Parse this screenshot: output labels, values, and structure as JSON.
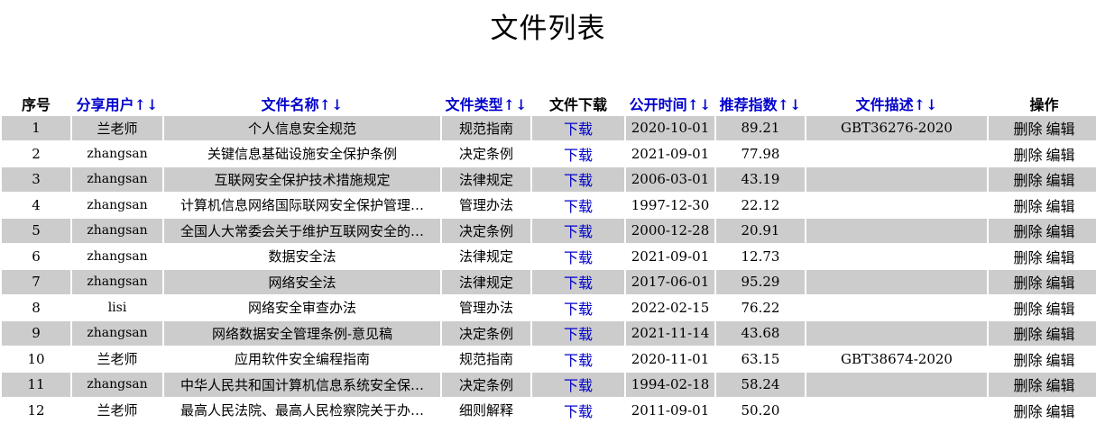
{
  "title": "文件列表",
  "columns": [
    {
      "label": "序号",
      "sortable": false
    },
    {
      "label": "分享用户↑↓",
      "sortable": true
    },
    {
      "label": "文件名称↑↓",
      "sortable": true
    },
    {
      "label": "文件类型↑↓",
      "sortable": true
    },
    {
      "label": "文件下载",
      "sortable": false
    },
    {
      "label": "公开时间↑↓",
      "sortable": true
    },
    {
      "label": "推荐指数↑↓",
      "sortable": true
    },
    {
      "label": "文件描述↑↓",
      "sortable": true
    },
    {
      "label": "操作",
      "sortable": false
    }
  ],
  "download_label": "下载",
  "delete_label": "删除",
  "edit_label": "编辑",
  "rows": [
    {
      "no": "1",
      "user": "兰老师",
      "name": "个人信息安全规范",
      "type": "规范指南",
      "date": "2020-10-01",
      "score": "89.21",
      "desc": "GBT36276-2020"
    },
    {
      "no": "2",
      "user": "zhangsan",
      "name": "关键信息基础设施安全保护条例",
      "type": "决定条例",
      "date": "2021-09-01",
      "score": "77.98",
      "desc": ""
    },
    {
      "no": "3",
      "user": "zhangsan",
      "name": "互联网安全保护技术措施规定",
      "type": "法律规定",
      "date": "2006-03-01",
      "score": "43.19",
      "desc": ""
    },
    {
      "no": "4",
      "user": "zhangsan",
      "name": "计算机信息网络国际联网安全保护管理…",
      "type": "管理办法",
      "date": "1997-12-30",
      "score": "22.12",
      "desc": ""
    },
    {
      "no": "5",
      "user": "zhangsan",
      "name": "全国人大常委会关于维护互联网安全的…",
      "type": "决定条例",
      "date": "2000-12-28",
      "score": "20.91",
      "desc": ""
    },
    {
      "no": "6",
      "user": "zhangsan",
      "name": "数据安全法",
      "type": "法律规定",
      "date": "2021-09-01",
      "score": "12.73",
      "desc": ""
    },
    {
      "no": "7",
      "user": "zhangsan",
      "name": "网络安全法",
      "type": "法律规定",
      "date": "2017-06-01",
      "score": "95.29",
      "desc": ""
    },
    {
      "no": "8",
      "user": "lisi",
      "name": "网络安全审查办法",
      "type": "管理办法",
      "date": "2022-02-15",
      "score": "76.22",
      "desc": ""
    },
    {
      "no": "9",
      "user": "zhangsan",
      "name": "网络数据安全管理条例-意见稿",
      "type": "决定条例",
      "date": "2021-11-14",
      "score": "43.68",
      "desc": ""
    },
    {
      "no": "10",
      "user": "兰老师",
      "name": "应用软件安全编程指南",
      "type": "规范指南",
      "date": "2020-11-01",
      "score": "63.15",
      "desc": "GBT38674-2020"
    },
    {
      "no": "11",
      "user": "zhangsan",
      "name": "中华人民共和国计算机信息系统安全保…",
      "type": "决定条例",
      "date": "1994-02-18",
      "score": "58.24",
      "desc": ""
    },
    {
      "no": "12",
      "user": "兰老师",
      "name": "最高人民法院、最高人民检察院关于办…",
      "type": "细则解释",
      "date": "2011-09-01",
      "score": "50.20",
      "desc": ""
    }
  ]
}
